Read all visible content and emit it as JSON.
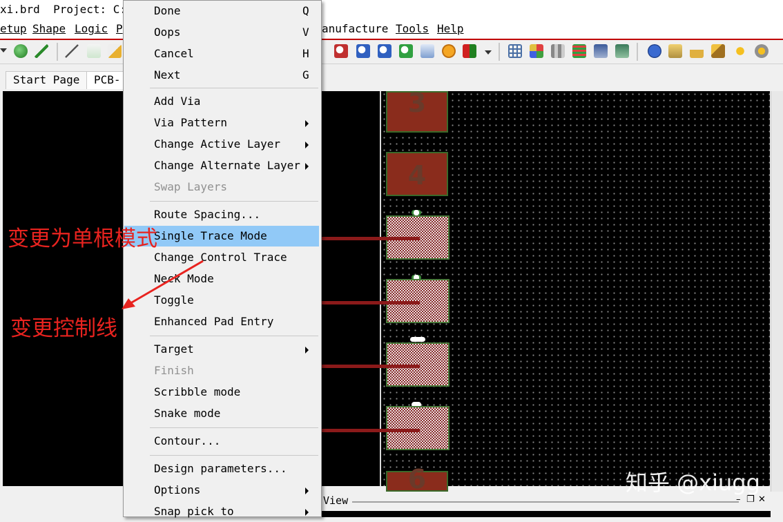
{
  "window": {
    "title": "xi.brd  Project: C:..."
  },
  "menubar": {
    "items": [
      "etup",
      "Shape",
      "Logic",
      "P",
      "anufacture",
      "Tools",
      "Help"
    ]
  },
  "tabs": [
    {
      "label": "Start Page"
    },
    {
      "label": "PCB-"
    }
  ],
  "context_menu": {
    "groups": [
      [
        {
          "label": "Done",
          "shortcut": "Q"
        },
        {
          "label": "Oops",
          "shortcut": "V"
        },
        {
          "label": "Cancel",
          "shortcut": "H"
        },
        {
          "label": "Next",
          "shortcut": "G"
        }
      ],
      [
        {
          "label": "Add Via"
        },
        {
          "label": "Via Pattern",
          "submenu": true
        },
        {
          "label": "Change Active Layer",
          "submenu": true
        },
        {
          "label": "Change Alternate Layer",
          "submenu": true
        },
        {
          "label": "Swap Layers",
          "disabled": true
        }
      ],
      [
        {
          "label": "Route Spacing..."
        },
        {
          "label": "Single Trace Mode",
          "highlighted": true
        },
        {
          "label": "Change Control Trace"
        },
        {
          "label": "Neck Mode"
        },
        {
          "label": "Toggle"
        },
        {
          "label": "Enhanced Pad Entry"
        }
      ],
      [
        {
          "label": "Target",
          "submenu": true
        },
        {
          "label": "Finish",
          "disabled": true
        },
        {
          "label": "Scribble mode"
        },
        {
          "label": "Snake mode"
        }
      ],
      [
        {
          "label": "Contour..."
        }
      ],
      [
        {
          "label": "Design parameters..."
        },
        {
          "label": "Options",
          "submenu": true
        },
        {
          "label": "Snap pick to",
          "submenu": true
        }
      ]
    ]
  },
  "annotations": {
    "single_trace": "变更为单根模式",
    "control_trace": "变更控制线",
    "color": "#e8231f"
  },
  "canvas": {
    "pad_numbers": [
      "3",
      "4",
      "6"
    ]
  },
  "bottom_panel": {
    "label": "View"
  },
  "watermark": "知乎 @xiugg",
  "colors": {
    "menu_highlight": "#91c9f7",
    "menubar_accent": "#c00000",
    "trace": "#8b1a1a"
  }
}
